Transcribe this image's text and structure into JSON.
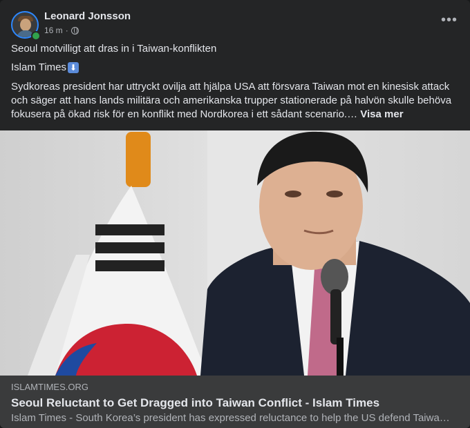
{
  "post": {
    "author": "Leonard Jonsson",
    "time": "16 m",
    "separator": "·",
    "privacy_icon": "globe-icon",
    "more_icon": "more-options-icon",
    "line1": "Seoul motvilligt att dras in i Taiwan-konflikten",
    "line2": "Islam Times",
    "line2_emoji": "⬇",
    "body": "Sydkoreas president har uttryckt ovilja att hjälpa USA att försvara Taiwan mot en kinesisk attack och säger att hans lands militära och amerikanska trupper stationerade på halvön skulle behöva fokusera på ökad risk för en konflikt med Nordkorea i ett sådant scenario.…",
    "see_more": "Visa mer"
  },
  "link_preview": {
    "domain": "ISLAMTIMES.ORG",
    "title": "Seoul Reluctant to Get Dragged into Taiwan Conflict - Islam Times",
    "description": "Islam Times - South Korea’s president has expressed reluctance to help the US defend Taiwan from a Chinese attack"
  },
  "colors": {
    "background": "#242526",
    "preview_bg": "#3a3b3c",
    "text_primary": "#e4e6eb",
    "text_secondary": "#b0b3b8",
    "online": "#31a24c"
  }
}
